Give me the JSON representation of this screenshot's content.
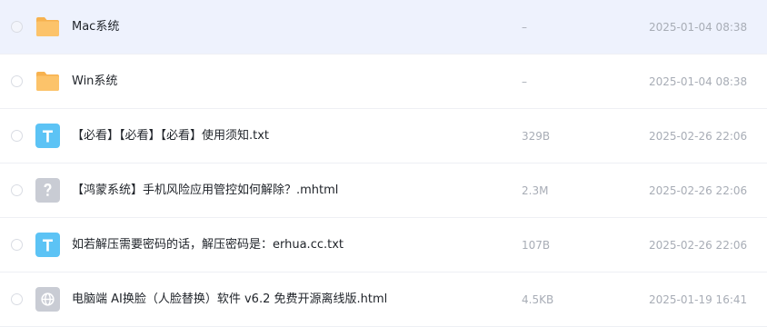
{
  "files": [
    {
      "name": "Mac系统",
      "size": "–",
      "date": "2025-01-04 08:38",
      "icon": "folder-icon",
      "highlighted": true
    },
    {
      "name": "Win系统",
      "size": "–",
      "date": "2025-01-04 08:38",
      "icon": "folder-icon",
      "highlighted": false
    },
    {
      "name": "【必看】【必看】【必看】使用须知.txt",
      "size": "329B",
      "date": "2025-02-26 22:06",
      "icon": "txt-file-icon",
      "highlighted": false
    },
    {
      "name": "【鸿蒙系统】手机风险应用管控如何解除？.mhtml",
      "size": "2.3M",
      "date": "2025-02-26 22:06",
      "icon": "unknown-file-icon",
      "highlighted": false
    },
    {
      "name": "如若解压需要密码的话，解压密码是：erhua.cc.txt",
      "size": "107B",
      "date": "2025-02-26 22:06",
      "icon": "txt-file-icon",
      "highlighted": false
    },
    {
      "name": "电脑端 AI换脸（人脸替换）软件 v6.2 免费开源离线版.html",
      "size": "4.5KB",
      "date": "2025-01-19 16:41",
      "icon": "html-file-icon",
      "highlighted": false
    }
  ],
  "colors": {
    "folder": "#fcc36a",
    "txt": "#5cc3f5",
    "unknown": "#c9ccd4",
    "html": "#c9ccd4",
    "highlight": "#eef2fd"
  }
}
